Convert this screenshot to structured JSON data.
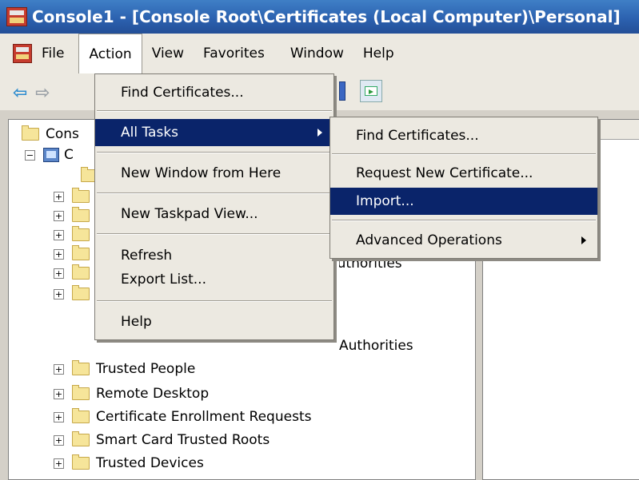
{
  "window": {
    "title": "Console1 - [Console Root\\Certificates (Local Computer)\\Personal]"
  },
  "menubar": {
    "items": [
      "File",
      "Action",
      "View",
      "Favorites",
      "Window",
      "Help"
    ]
  },
  "tree": {
    "root_partial": "Cons",
    "child_partial": "C",
    "partial_fragments": {
      "authorities_1": "Authorities",
      "authorities_2": "Authorities"
    },
    "items": [
      "Trusted People",
      "Remote Desktop",
      "Certificate Enrollment Requests",
      "Smart Card Trusted Roots",
      "Trusted Devices"
    ]
  },
  "action_menu": {
    "items": {
      "find_certificates": "Find Certificates...",
      "all_tasks": "All Tasks",
      "new_window": "New Window from Here",
      "new_taskpad": "New Taskpad View...",
      "refresh": "Refresh",
      "export_list": "Export List...",
      "help": "Help"
    }
  },
  "all_tasks_submenu": {
    "items": {
      "find_certificates": "Find Certificates...",
      "request_new": "Request New Certificate...",
      "import": "Import...",
      "advanced": "Advanced Operations"
    }
  },
  "icons": {
    "app": "mmc-console-icon",
    "back": "back-arrow-icon",
    "forward": "forward-arrow-icon",
    "folder": "folder-icon",
    "computer": "computer-icon",
    "submenu": "submenu-arrow-icon"
  },
  "colors": {
    "titlebar": "#2c62b0",
    "highlight": "#0a246a",
    "menu_bg": "#ece9e1",
    "folder": "#f6e59a"
  }
}
